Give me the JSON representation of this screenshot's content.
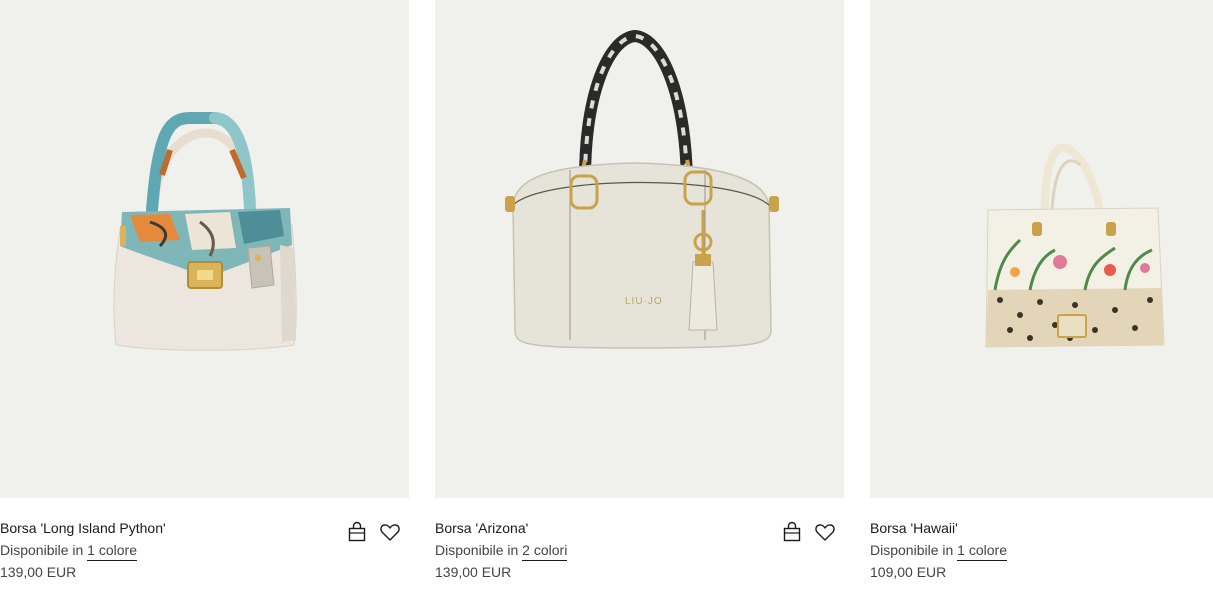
{
  "products": [
    {
      "name": "Borsa 'Long Island Python'",
      "availability_prefix": "Disponibile in",
      "availability_link": "1 colore",
      "price": "139,00 EUR",
      "icons": [
        "shopping-bag-icon",
        "heart-icon"
      ]
    },
    {
      "name": "Borsa 'Arizona'",
      "availability_prefix": "Disponibile in",
      "availability_link": "2 colori",
      "price": "139,00 EUR",
      "brand_mark": "LIU·JO",
      "icons": [
        "shopping-bag-icon",
        "heart-icon"
      ]
    },
    {
      "name": "Borsa 'Hawaii'",
      "availability_prefix": "Disponibile in",
      "availability_link": "1 colore",
      "price": "109,00 EUR"
    }
  ],
  "colors": {
    "photo_background": "#f0f0ec",
    "text": "#1a1a1a",
    "muted_text": "#444444"
  }
}
